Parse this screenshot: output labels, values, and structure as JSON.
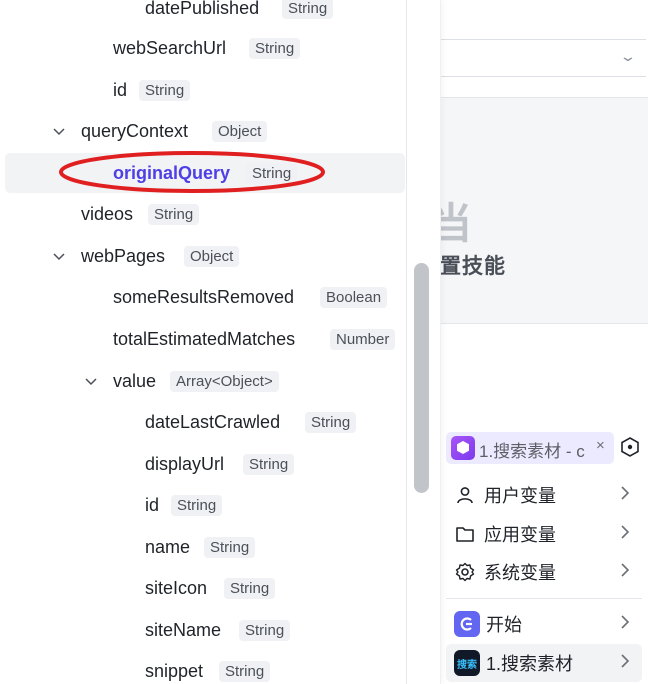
{
  "tree": {
    "rows": [
      {
        "name": "datePublished",
        "type": "String"
      },
      {
        "name": "webSearchUrl",
        "type": "String"
      },
      {
        "name": "id",
        "type": "String"
      },
      {
        "name": "queryContext",
        "type": "Object"
      },
      {
        "name": "originalQuery",
        "type": "String"
      },
      {
        "name": "videos",
        "type": "String"
      },
      {
        "name": "webPages",
        "type": "Object"
      },
      {
        "name": "someResultsRemoved",
        "type": "Boolean"
      },
      {
        "name": "totalEstimatedMatches",
        "type": "Number"
      },
      {
        "name": "value",
        "type": "Array<Object>"
      },
      {
        "name": "dateLastCrawled",
        "type": "String"
      },
      {
        "name": "displayUrl",
        "type": "String"
      },
      {
        "name": "id",
        "type": "String"
      },
      {
        "name": "name",
        "type": "String"
      },
      {
        "name": "siteIcon",
        "type": "String"
      },
      {
        "name": "siteName",
        "type": "String"
      },
      {
        "name": "snippet",
        "type": "String"
      }
    ]
  },
  "background": {
    "skill_glyph": "当",
    "skill_text": "置技能"
  },
  "variable_picker": {
    "node_tag_label": "1.搜索素材 - c",
    "close_glyph": "×",
    "items": [
      {
        "label": "用户变量"
      },
      {
        "label": "应用变量"
      },
      {
        "label": "系统变量"
      }
    ],
    "nodes": [
      {
        "label": "开始"
      },
      {
        "label": "1.搜索素材"
      }
    ],
    "search_badge_text": "搜索"
  },
  "colors": {
    "accent": "#4e40e5",
    "annotation_red": "#e02020"
  }
}
